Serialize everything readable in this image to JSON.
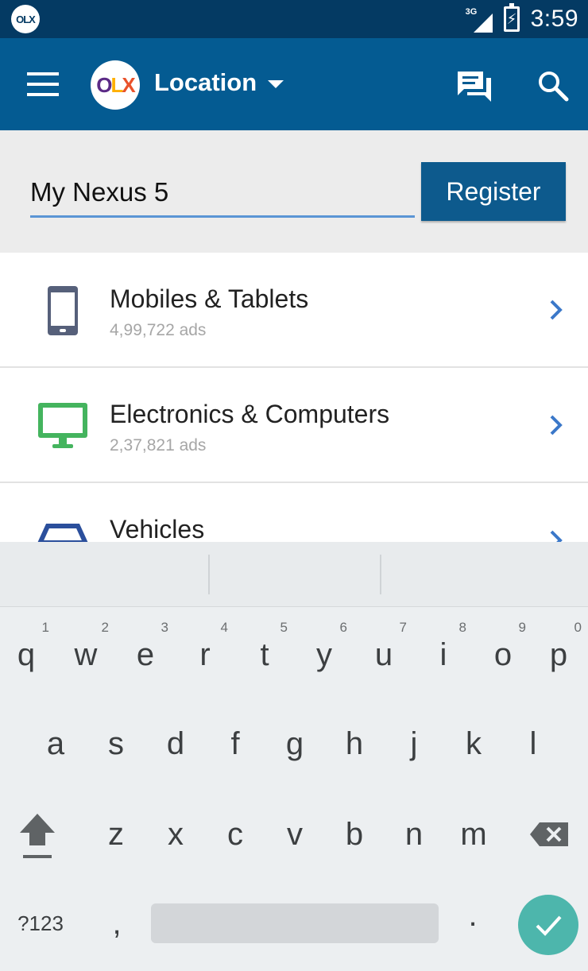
{
  "status_bar": {
    "app_badge": "OLX",
    "network": "3G",
    "time": "3:59"
  },
  "app_bar": {
    "logo_letters": [
      "O",
      "L",
      "X"
    ],
    "location_label": "Location"
  },
  "register_row": {
    "input_value": "My Nexus 5",
    "register_label": "Register"
  },
  "categories": [
    {
      "title": "Mobiles & Tablets",
      "count": "4,99,722 ads",
      "icon": "mobile-phone-icon"
    },
    {
      "title": "Electronics & Computers",
      "count": "2,37,821 ads",
      "icon": "computer-monitor-icon"
    },
    {
      "title": "Vehicles",
      "count": "",
      "icon": "car-icon"
    }
  ],
  "keyboard": {
    "row1": [
      {
        "key": "q",
        "hint": "1"
      },
      {
        "key": "w",
        "hint": "2"
      },
      {
        "key": "e",
        "hint": "3"
      },
      {
        "key": "r",
        "hint": "4"
      },
      {
        "key": "t",
        "hint": "5"
      },
      {
        "key": "y",
        "hint": "6"
      },
      {
        "key": "u",
        "hint": "7"
      },
      {
        "key": "i",
        "hint": "8"
      },
      {
        "key": "o",
        "hint": "9"
      },
      {
        "key": "p",
        "hint": "0"
      }
    ],
    "row2": [
      "a",
      "s",
      "d",
      "f",
      "g",
      "h",
      "j",
      "k",
      "l"
    ],
    "row3": [
      "z",
      "x",
      "c",
      "v",
      "b",
      "n",
      "m"
    ],
    "symbols_label": "?123",
    "comma": ",",
    "period": "."
  },
  "colors": {
    "status_bar": "#043a63",
    "app_bar": "#045b92",
    "register_button": "#0d5a8d",
    "input_underline": "#5b95d5",
    "enter_key": "#4db6ac",
    "chevron": "#3b78c9"
  }
}
